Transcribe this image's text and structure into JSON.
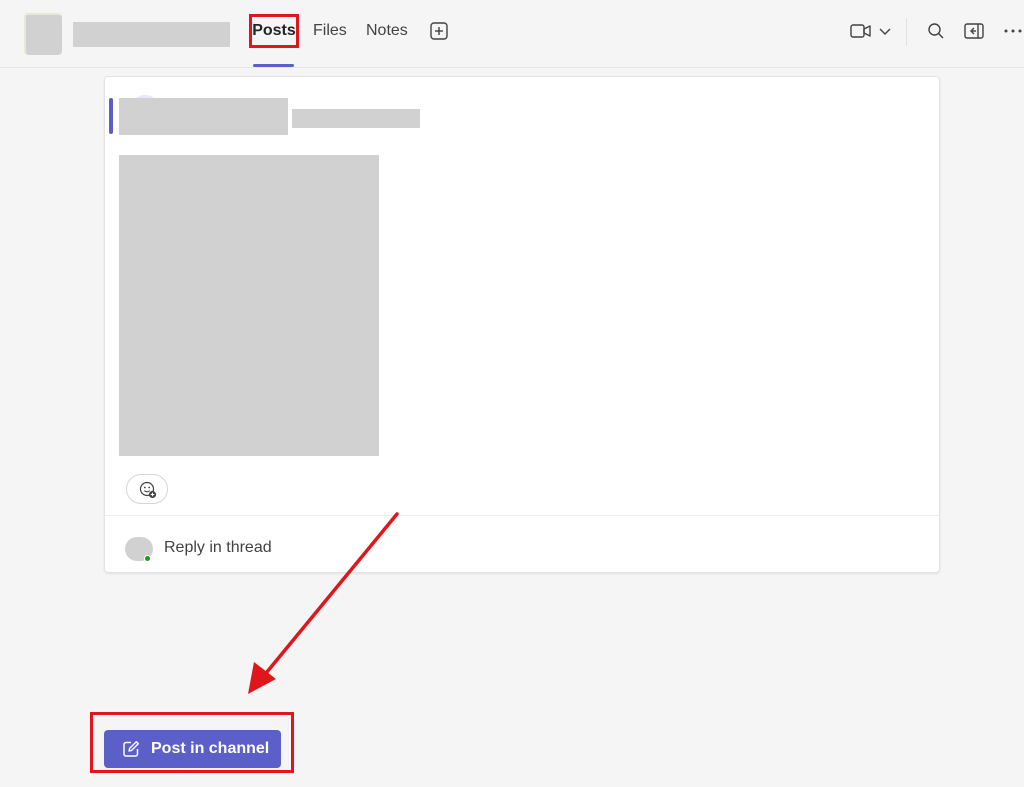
{
  "header": {
    "tabs": [
      {
        "label": "Posts",
        "selected": true
      },
      {
        "label": "Files",
        "selected": false
      },
      {
        "label": "Notes",
        "selected": false
      }
    ],
    "add_tab_icon": "plus-square-icon",
    "actions": [
      {
        "name": "video-camera-icon"
      },
      {
        "name": "chevron-down-icon"
      },
      {
        "name": "search-icon"
      },
      {
        "name": "side-panel-icon"
      },
      {
        "name": "more-options-icon"
      }
    ]
  },
  "post": {
    "reaction_icon": "emoji-add-icon",
    "reply_label": "Reply in thread"
  },
  "composer": {
    "post_button_label": "Post in channel",
    "post_button_icon": "compose-icon"
  },
  "colors": {
    "accent": "#5b5fc7",
    "annotation": "#e0161d",
    "presence": "#13a10e"
  }
}
